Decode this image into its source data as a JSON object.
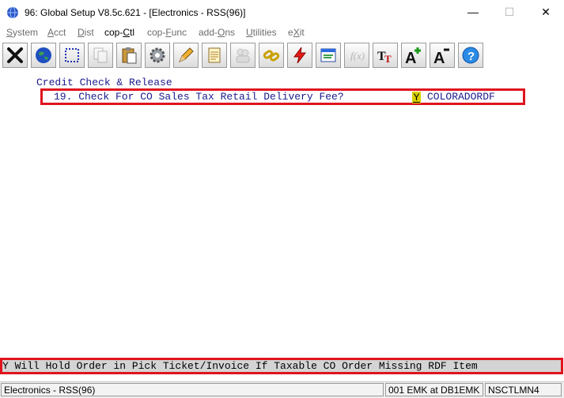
{
  "window": {
    "title": "96: Global Setup V8.5c.621 - [Electronics - RSS(96)]",
    "minimize": "—",
    "maximize": "☐",
    "close": "✕"
  },
  "menu": {
    "items": [
      "System",
      "Acct",
      "Dist",
      "cop-Ctl",
      "cop-Func",
      "add-Ons",
      "Utilities",
      "eXit"
    ],
    "active": "cop-Ctl"
  },
  "toolbar": {
    "buttons": [
      "close-x",
      "globe",
      "select-region",
      "copy",
      "paste",
      "settings-gear",
      "edit-pencil",
      "notepad",
      "users",
      "links",
      "lightning",
      "report-window",
      "function",
      "text-format",
      "font-increase",
      "font-decrease",
      "help"
    ]
  },
  "content": {
    "section_title": "Credit Check & Release",
    "question": {
      "number_label": "19. Check For CO Sales Tax Retail Delivery Fee?",
      "value": "Y",
      "code": "COLORADORDF"
    },
    "help_line": "Y Will Hold Order in Pick Ticket/Invoice If Taxable CO Order Missing RDF Item"
  },
  "status": {
    "left": "Electronics - RSS(96)",
    "user": "001 EMK at DB1EMK",
    "program": "NSCTLMN4"
  },
  "colors": {
    "highlight_border": "#e0141e",
    "field_value_bg": "#d8d000",
    "text_blue": "#1a1a8c"
  }
}
